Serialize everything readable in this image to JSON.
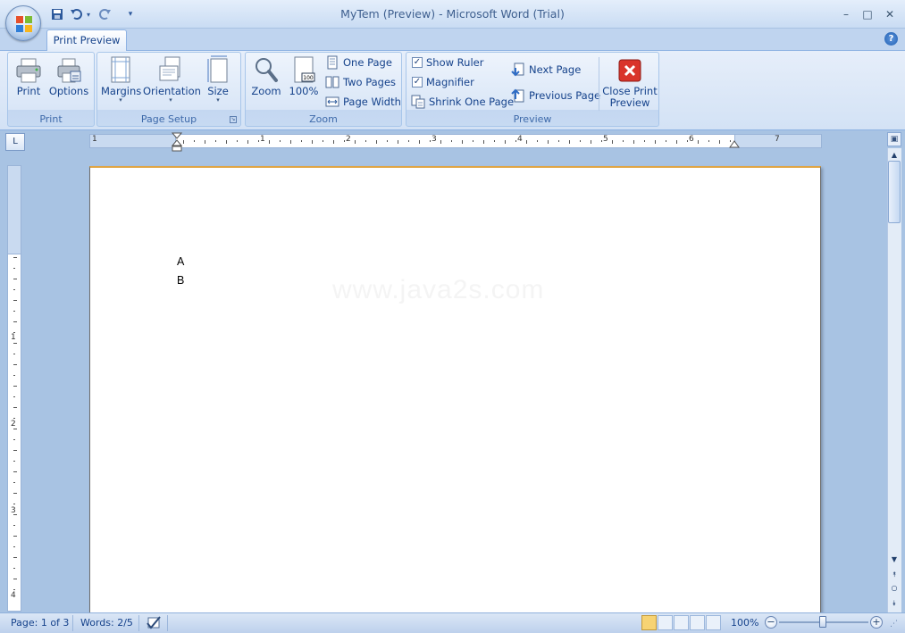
{
  "window": {
    "title": "MyTem (Preview)  -  Microsoft Word (Trial)",
    "minimize": "–",
    "maximize": "□",
    "close": "✕"
  },
  "tabs": {
    "active": "Print Preview"
  },
  "help": "?",
  "ribbon": {
    "print": {
      "label": "Print",
      "print_button": "Print",
      "options_button": "Options"
    },
    "page_setup": {
      "label": "Page Setup",
      "margins": "Margins",
      "orientation": "Orientation",
      "size": "Size"
    },
    "zoom": {
      "label": "Zoom",
      "zoom_button": "Zoom",
      "hundred_button": "100%",
      "one_page": "One Page",
      "two_pages": "Two Pages",
      "page_width": "Page Width"
    },
    "preview": {
      "label": "Preview",
      "show_ruler": "Show Ruler",
      "show_ruler_checked": true,
      "magnifier": "Magnifier",
      "magnifier_checked": true,
      "shrink_one_page": "Shrink One Page",
      "next_page": "Next Page",
      "previous_page": "Previous Page",
      "close_line1": "Close Print",
      "close_line2": "Preview"
    }
  },
  "ruler": {
    "h_numbers": [
      "1",
      "1",
      "2",
      "3",
      "4",
      "5",
      "6",
      "7"
    ],
    "v_numbers": [
      "1",
      "1",
      "2",
      "3",
      "4"
    ]
  },
  "document": {
    "lines": [
      "A",
      "B"
    ],
    "watermark": "www.java2s.com"
  },
  "status": {
    "page": "Page: 1 of 3",
    "words": "Words: 2/5",
    "zoom": "100%"
  },
  "colors": {
    "ribbon_bg": "#d3e2f5",
    "frame_bg": "#a8c3e3",
    "text_blue": "#15428b",
    "close_red": "#d9342b"
  }
}
